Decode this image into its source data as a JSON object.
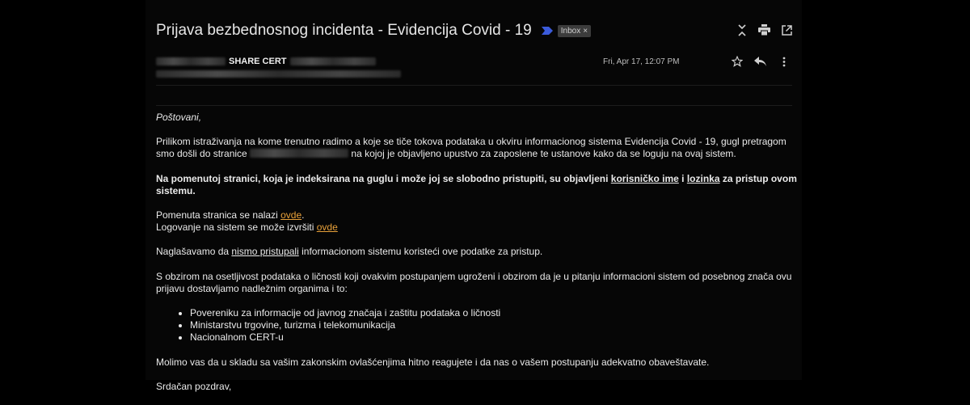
{
  "header": {
    "subject": "Prijava bezbednosnog incidenta - Evidencija Covid - 19",
    "label": "Inbox",
    "label_remove": "×"
  },
  "message": {
    "sender_name": "SHARE CERT",
    "date": "Fri, Apr 17, 12:07 PM"
  },
  "icons": {
    "top": [
      "collapse-icon",
      "print-icon",
      "open-in-new-window-icon"
    ],
    "message": [
      "star-icon",
      "reply-icon",
      "more-vert-icon"
    ],
    "importance": "importance-marker-icon"
  },
  "body": {
    "greeting": "Poštovani,",
    "p1_a": "Prilikom istraživanja na kome trenutno radimo a koje se tiče tokova podataka u okviru informacionog sistema Evidencija Covid - 19, gugl pretragom smo došli do stranice",
    "p1_b": "na kojoj je objavljeno upustvo za zaposlene te ustanove kako da se loguju na ovaj sistem.",
    "p2_a": "Na pomenutoj stranici, koja je indeksirana na guglu i može joj se slobodno pristupiti, su objavljeni ",
    "p2_u1": "korisničko ime",
    "p2_b": " i ",
    "p2_u2": "lozinka",
    "p2_c": " za pristup ovom sistemu.",
    "p3_a": "Pomenuta stranica se nalazi ",
    "p3_link": "ovde",
    "p3_b": ".",
    "p4_a": "Logovanje na sistem se može izvršiti ",
    "p4_link": "ovde",
    "p5_a": "Naglašavamo da ",
    "p5_u": "nismo pristupali",
    "p5_b": " informacionom sistemu koristeći ove podatke za pristup.",
    "p6": "S obzirom na osetljivost podataka o ličnosti koji ovakvim postupanjem ugroženi i obzirom da je u pitanju informacioni sistem od posebnog značа ovu prijavu dostavljamo nadležnim organima i to:",
    "list": [
      "Povereniku za informacije od javnog značaja i zaštitu podataka o ličnosti",
      "Ministarstvu trgovine, turizma i telekomunikacija",
      "Nacionalnom CERT-u"
    ],
    "p7": "Molimo vas da u skladu sa vašim zakonskim ovlašćenjima hitno reagujete i da nas o vašem postupanju adekvatno obaveštavate.",
    "closing": "Srdačan pozdrav,"
  },
  "colors": {
    "background": "#000000",
    "link": "#e8a13a",
    "importance": "#3b5bdb"
  }
}
